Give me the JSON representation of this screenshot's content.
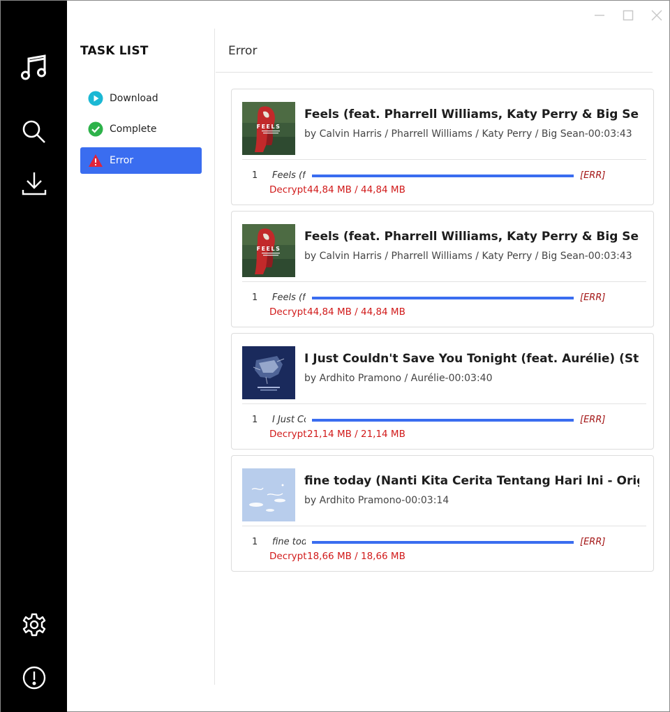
{
  "rail": {
    "icons": [
      "music-icon",
      "search-icon",
      "download-icon",
      "gear-icon",
      "info-icon"
    ]
  },
  "window_controls": [
    "minimize-icon",
    "maximize-icon",
    "close-icon"
  ],
  "tasklist": {
    "title": "TASK LIST",
    "items": [
      {
        "label": "Download",
        "icon": "play-circle-icon",
        "color": "#1bb8d4"
      },
      {
        "label": "Complete",
        "icon": "check-circle-icon",
        "color": "#2db24a"
      },
      {
        "label": "Error",
        "icon": "warning-icon",
        "color": "#e0243a",
        "active": true
      }
    ]
  },
  "main": {
    "title": "Error",
    "tasks": [
      {
        "title": "Feels (feat. Pharrell Williams, Katy Perry & Big Sean)",
        "subtitle": "by Calvin Harris / Pharrell Williams / Katy Perry / Big Sean-00:03:43",
        "cover": "feels-cover",
        "index": "1",
        "name": "Feels (feat. Pharrell Williams, Katy Perry & Big Sean)",
        "progress": 1.0,
        "error": "[ERR]",
        "status": "Decrypt failed",
        "size": "44,84 MB / 44,84 MB"
      },
      {
        "title": "Feels (feat. Pharrell Williams, Katy Perry & Big Sean)",
        "subtitle": "by Calvin Harris / Pharrell Williams / Katy Perry / Big Sean-00:03:43",
        "cover": "feels-cover",
        "index": "1",
        "name": "Feels (feat. Pharrell Williams, Katy Perry & Big Sean)",
        "progress": 1.0,
        "error": "[ERR]",
        "status": "Decrypt failed",
        "size": "44,84 MB / 44,84 MB"
      },
      {
        "title": "I Just Couldn't Save You Tonight (feat. Aurélie) (Story of Aurelie Lightning)",
        "subtitle": "by Ardhito Pramono / Aurélie-00:03:40",
        "cover": "save-you-cover",
        "index": "1",
        "name": "I Just Couldn't Save You Tonight",
        "progress": 1.0,
        "error": "[ERR]",
        "status": "Decrypt failed",
        "size": "21,14 MB / 21,14 MB"
      },
      {
        "title": "fine today (Nanti Kita Cerita Tentang Hari Ini - Original Soundtrack)",
        "subtitle": "by Ardhito Pramono-00:03:14",
        "cover": "fine-today-cover",
        "index": "1",
        "name": "fine today",
        "progress": 1.0,
        "error": "[ERR]",
        "status": "Decrypt failed",
        "size": "18,66 MB / 18,66 MB"
      }
    ]
  }
}
